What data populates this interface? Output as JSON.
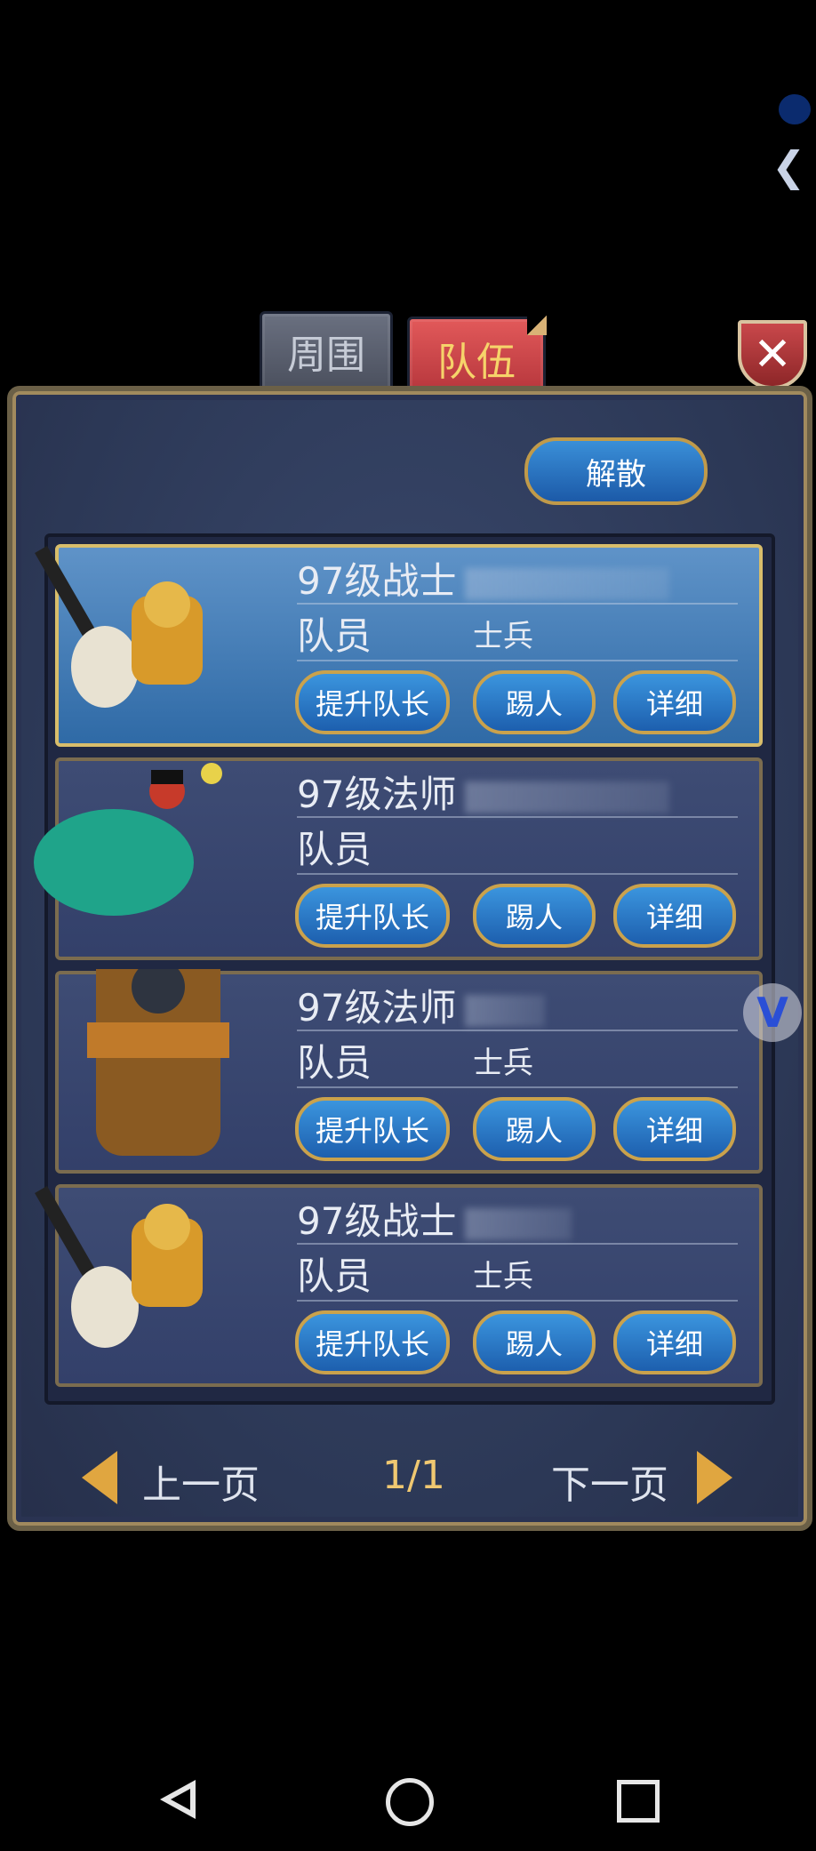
{
  "tabs": [
    {
      "label": "周围",
      "active": false
    },
    {
      "label": "队伍",
      "active": true
    }
  ],
  "close_label": "✕",
  "disband_label": "解散",
  "members": [
    {
      "title": "97级战士",
      "role": "队员",
      "extra": "士兵",
      "selected": true,
      "buttons": {
        "promote": "提升队长",
        "kick": "踢人",
        "detail": "详细"
      }
    },
    {
      "title": "97级法师",
      "role": "队员",
      "extra": "",
      "selected": false,
      "buttons": {
        "promote": "提升队长",
        "kick": "踢人",
        "detail": "详细"
      }
    },
    {
      "title": "97级法师",
      "role": "队员",
      "extra": "士兵",
      "selected": false,
      "buttons": {
        "promote": "提升队长",
        "kick": "踢人",
        "detail": "详细"
      }
    },
    {
      "title": "97级战士",
      "role": "队员",
      "extra": "士兵",
      "selected": false,
      "buttons": {
        "promote": "提升队长",
        "kick": "踢人",
        "detail": "详细"
      }
    }
  ],
  "pager": {
    "prev": "上一页",
    "next": "下一页",
    "page": "1/1"
  },
  "side_arrow": "❮",
  "float_badge": "V"
}
